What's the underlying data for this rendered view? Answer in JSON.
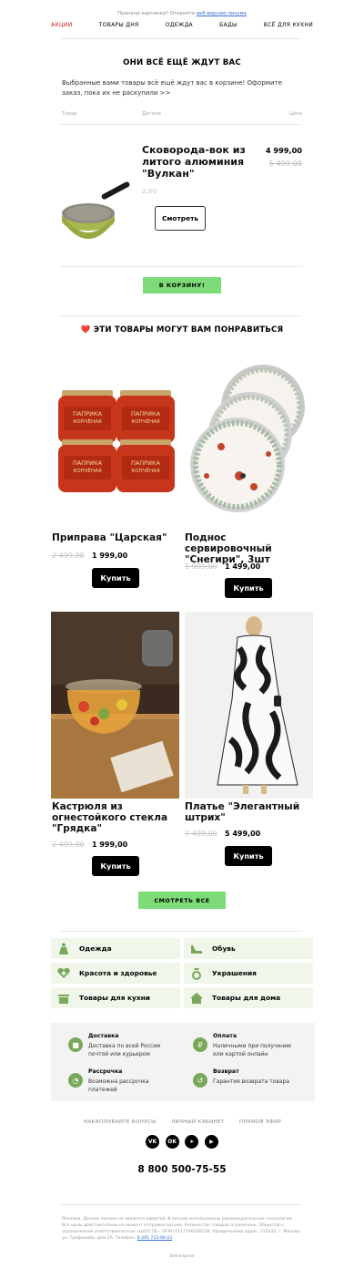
{
  "preheader": {
    "text": "Пропали картинки? Откройте ",
    "link": "веб-версию письма"
  },
  "nav": [
    "АКЦИИ",
    "ТОВАРЫ ДНЯ",
    "ОДЕЖДА",
    "БАДЫ",
    "ВСЁ ДЛЯ КУХНИ"
  ],
  "cart": {
    "heading": "ОНИ ВСЁ ЕЩЁ ЖДУТ ВАС",
    "text": "Выбранные вами товары всё ещё ждут вас в корзине! Оформите заказ, пока их не раскупили >>",
    "col_product": "Товар",
    "col_details": "Детали",
    "col_price": "Цена",
    "item_title": "Сковорода-вок из литого алюминия \"Вулкан\"",
    "item_qty": "2,00",
    "item_price": "4 999,00",
    "item_old_price": "5 499,00",
    "view_button": "Смотреть",
    "cart_button": "В КОРЗИНУ!"
  },
  "recommend": {
    "heading": "ЭТИ ТОВАРЫ МОГУТ ВАМ ПОНРАВИТЬСЯ",
    "heart": "❤️",
    "products": [
      {
        "name": "Приправа \"Царская\"",
        "old": "2 499,00",
        "price": "1 999,00",
        "button": "Купить"
      },
      {
        "name": "Поднос сервировочный \"Снегири\", 3шт",
        "old": "1 999,00",
        "price": "1 499,00",
        "button": "Купить"
      },
      {
        "name": "Кастрюля из огнестойкого стекла \"Грядка\"",
        "old": "2 499,00",
        "price": "1 999,00",
        "button": "Купить"
      },
      {
        "name": "Платье \"Элегантный штрих\"",
        "old": "7 499,00",
        "price": "5 499,00",
        "button": "Купить"
      }
    ],
    "jar_label": "ПАПРИКА КОПЧЁНАЯ",
    "see_all": "СМОТРЕТЬ ВСЕ"
  },
  "categories": [
    {
      "label": "Одежда",
      "icon": "dress-icon"
    },
    {
      "label": "Обувь",
      "icon": "shoe-icon"
    },
    {
      "label": "Красота и здоровье",
      "icon": "heart-plus-icon"
    },
    {
      "label": "Украшения",
      "icon": "ring-icon"
    },
    {
      "label": "Товары для кухни",
      "icon": "pot-icon"
    },
    {
      "label": "Товары для дома",
      "icon": "house-icon"
    }
  ],
  "services": [
    {
      "title": "Доставка",
      "text": "Доставка по всей России почтой или курьером",
      "icon": "box-icon"
    },
    {
      "title": "Оплата",
      "text": "Наличными при получении или картой онлайн",
      "icon": "ruble-icon"
    },
    {
      "title": "Рассрочка",
      "text": "Возможна рассрочка платежей",
      "icon": "clock-icon"
    },
    {
      "title": "Возврат",
      "text": "Гарантия возврата товара",
      "icon": "return-icon"
    }
  ],
  "footer": {
    "links": [
      "НАКАПЛИВАЙТЕ БОНУСЫ",
      "ЛИЧНЫЙ КАБИНЕТ",
      "ПРЯМОЙ ЭФИР"
    ],
    "social": [
      {
        "glyph": "VK",
        "icon": "vk-icon"
      },
      {
        "glyph": "OK",
        "icon": "odnoklassniki-icon"
      },
      {
        "glyph": "➤",
        "icon": "telegram-icon"
      },
      {
        "glyph": "▶",
        "icon": "youtube-icon"
      }
    ],
    "phone": "8 800 500-75-55",
    "legal": "Реклама. Данное письмо не является офертой. В письме использованы рекомендательные технологии. Все цены действительны на момент отправки письма. Количество товаров ограничено. Общество с ограниченной ответственностью «ШОП ТВ», ОГРН 5117746036128. Юридический адрес: 115432, г. Москва, ул. Трофимова, дом 2А. Телефон: ",
    "legal_phone": "8 495 733-96-03",
    "web_version": "Веб-версия"
  },
  "colors": {
    "accent_red": "#d01818",
    "green_button": "#7ddc78",
    "category_bg": "#f1f6ea",
    "icon_green": "#7aa85a"
  }
}
